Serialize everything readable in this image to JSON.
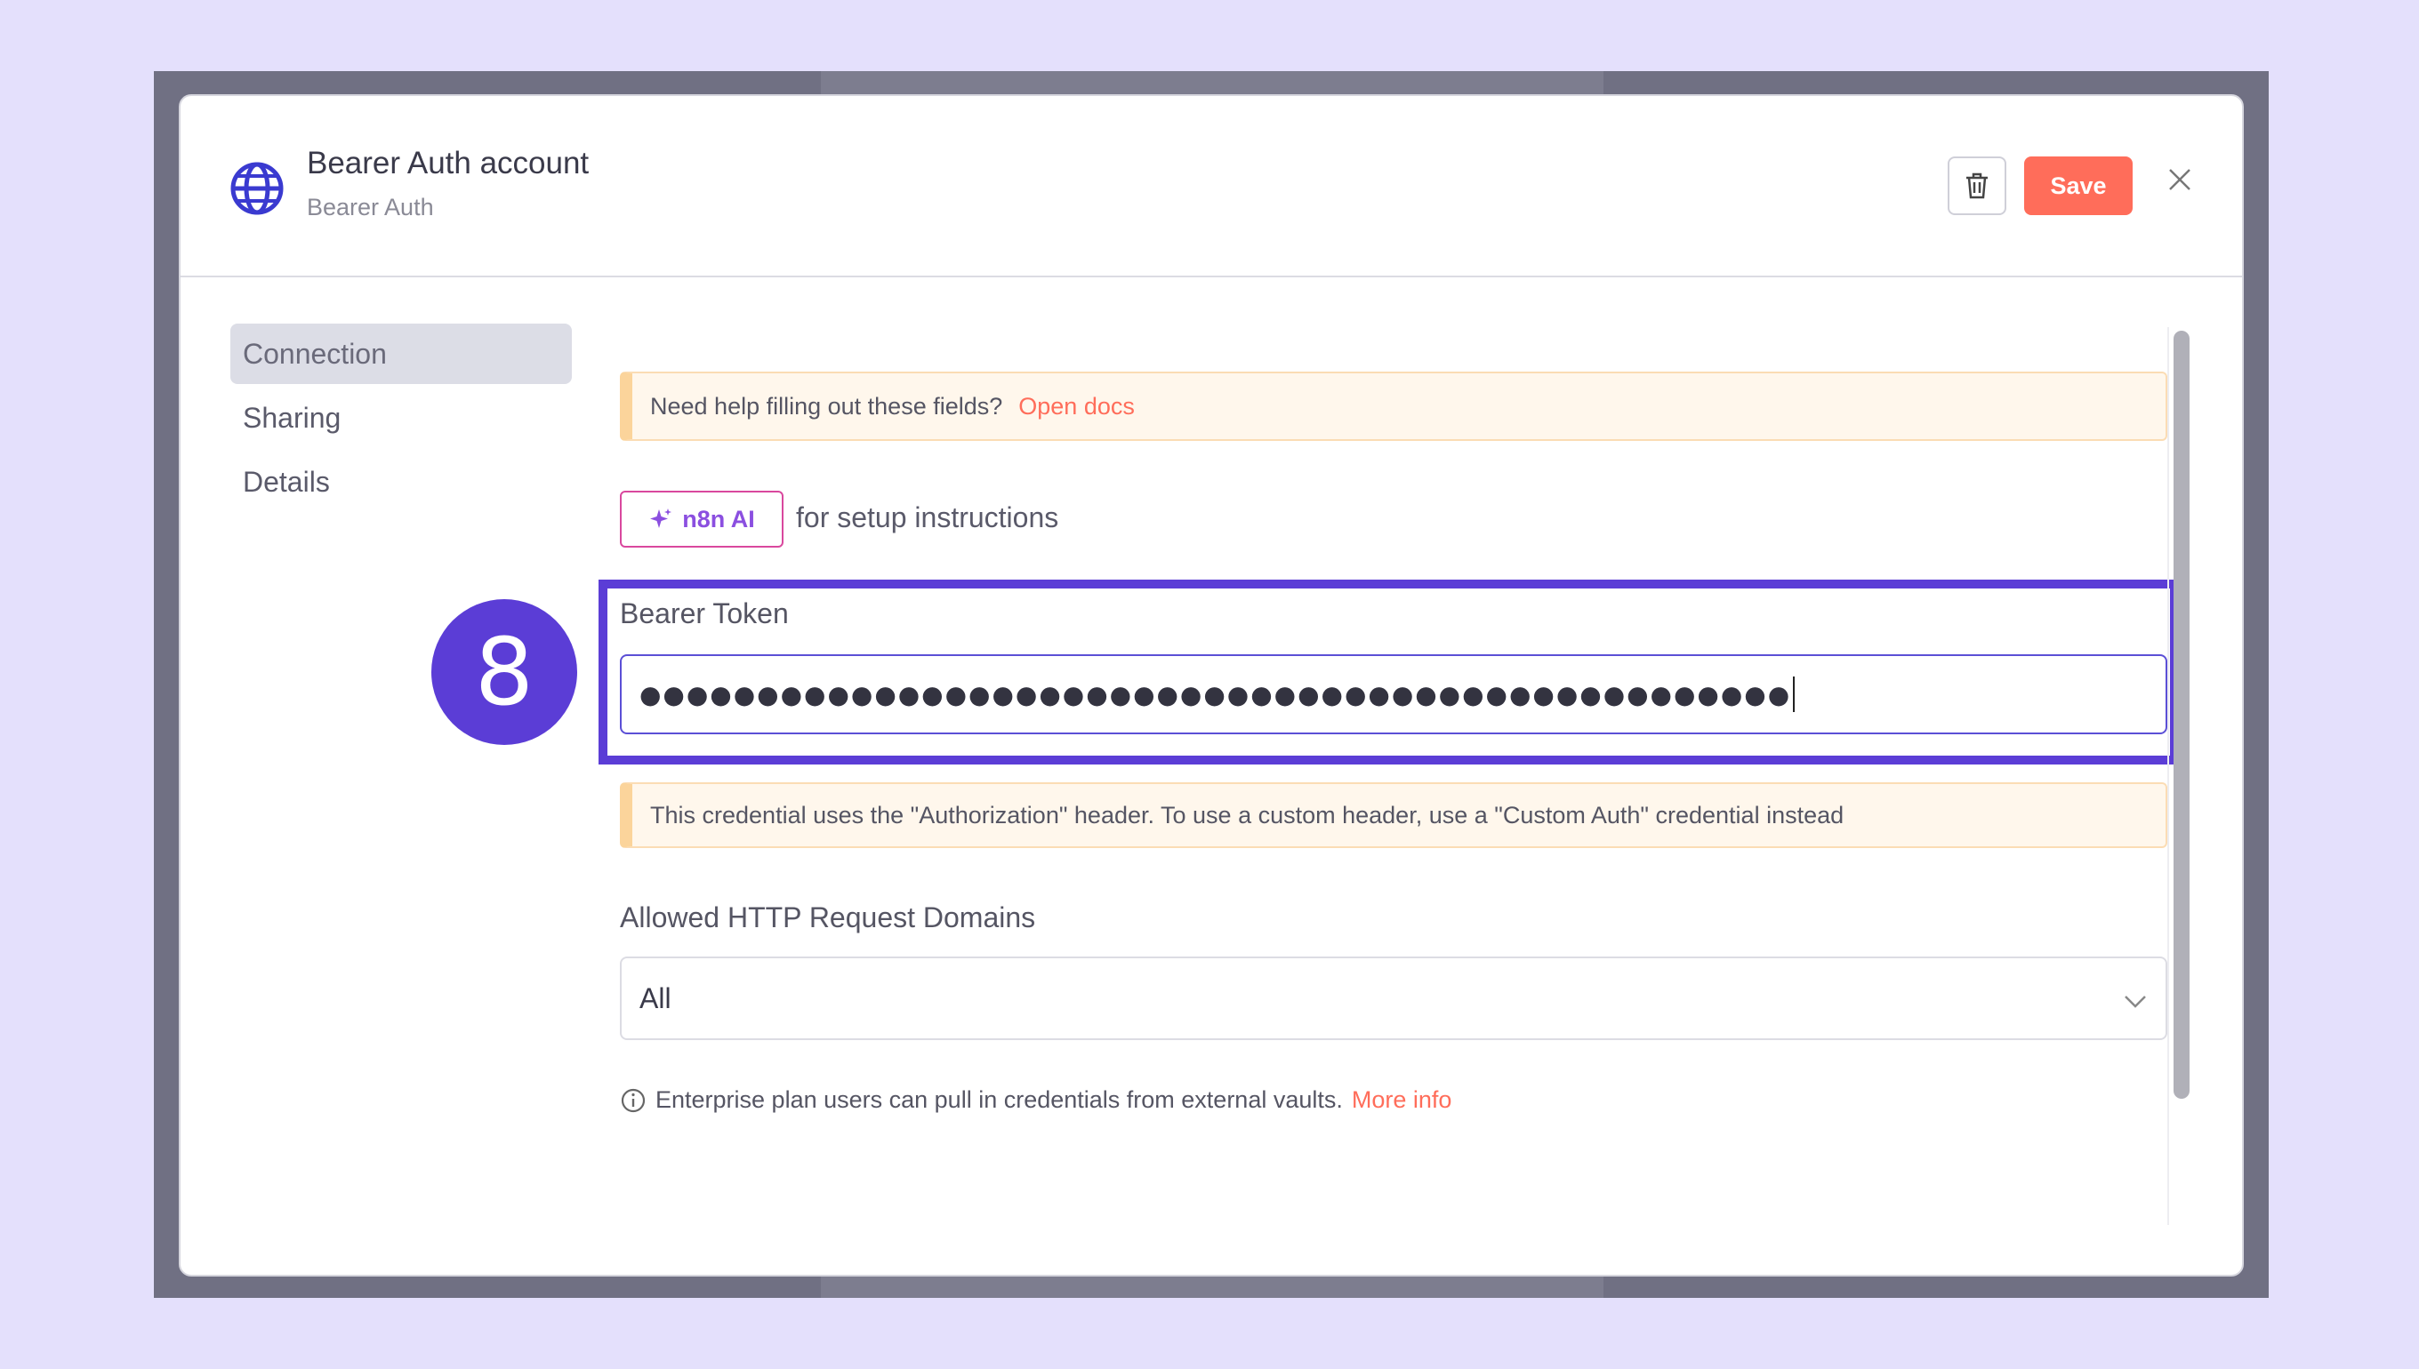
{
  "header": {
    "title": "Bearer Auth account",
    "subtitle": "Bearer Auth",
    "save_label": "Save"
  },
  "sidebar": {
    "items": [
      {
        "label": "Connection",
        "active": true
      },
      {
        "label": "Sharing",
        "active": false
      },
      {
        "label": "Details",
        "active": false
      }
    ]
  },
  "help_notice": {
    "text": "Need help filling out these fields?",
    "link": "Open docs"
  },
  "ai": {
    "button_label": "n8n AI",
    "hint": "for setup instructions"
  },
  "step_badge": "8",
  "bearer_token": {
    "label": "Bearer Token",
    "value_masked": "●●●●●●●●●●●●●●●●●●●●●●●●●●●●●●●●●●●●●●●●●●●●●●●●●"
  },
  "header_notice": {
    "text": "This credential uses the \"Authorization\" header. To use a custom header, use a \"Custom Auth\" credential instead"
  },
  "allowed_domains": {
    "label": "Allowed HTTP Request Domains",
    "selected": "All"
  },
  "enterprise_info": {
    "text": "Enterprise plan users can pull in credentials from external vaults.",
    "link": "More info"
  },
  "colors": {
    "accent": "#ff6d5a",
    "highlight": "#5b3dd6",
    "notice_bg": "#fff7ec"
  }
}
